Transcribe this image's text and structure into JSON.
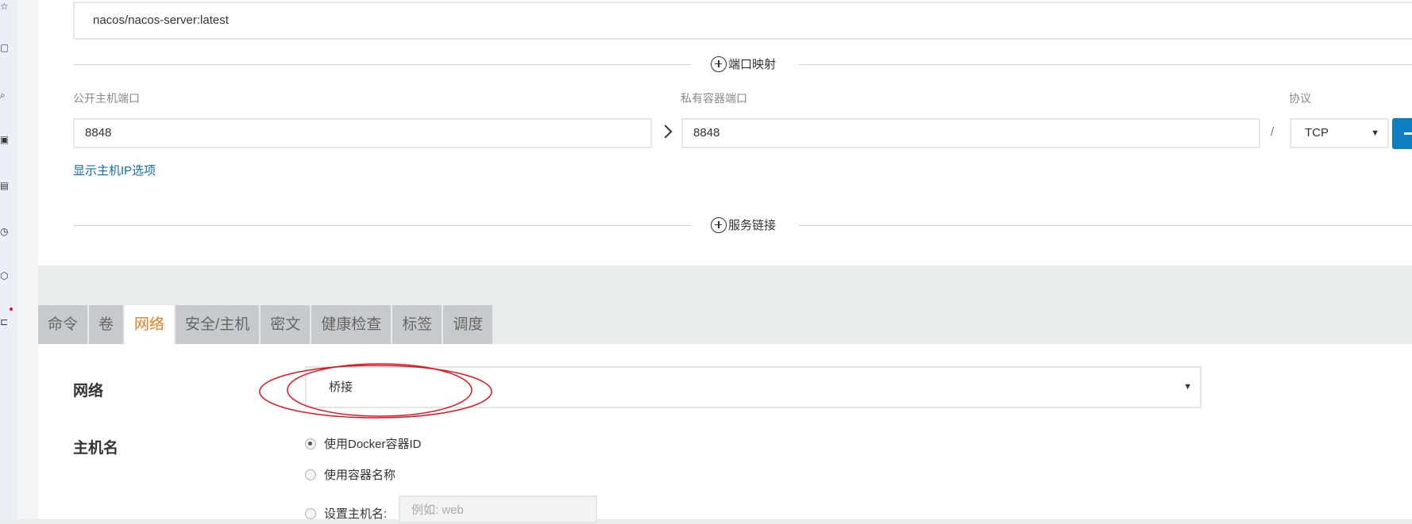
{
  "image": {
    "value": "nacos/nacos-server:latest"
  },
  "port_mapping": {
    "section_title": "端口映射",
    "public_port_label": "公开主机端口",
    "public_port_value": "8848",
    "private_port_label": "私有容器端口",
    "private_port_value": "8848",
    "slash": "/",
    "protocol_label": "协议",
    "protocol_value": "TCP",
    "show_host_ip_link": "显示主机IP选项"
  },
  "service_links": {
    "section_title": "服务链接"
  },
  "tabs": [
    {
      "label": "命令"
    },
    {
      "label": "卷"
    },
    {
      "label": "网络",
      "active": true
    },
    {
      "label": "安全/主机"
    },
    {
      "label": "密文"
    },
    {
      "label": "健康检查"
    },
    {
      "label": "标签"
    },
    {
      "label": "调度"
    }
  ],
  "network": {
    "label": "网络",
    "value": "桥接"
  },
  "hostname": {
    "label": "主机名",
    "options": [
      {
        "label": "使用Docker容器ID",
        "checked": true
      },
      {
        "label": "使用容器名称",
        "checked": false
      },
      {
        "label": "设置主机名:",
        "checked": false
      }
    ],
    "placeholder": "例如: web"
  },
  "colors": {
    "accent_orange": "#e87e1f",
    "link_blue": "#0d6ea8",
    "button_blue": "#0d7ec1",
    "annotation_red": "#e0141e"
  }
}
